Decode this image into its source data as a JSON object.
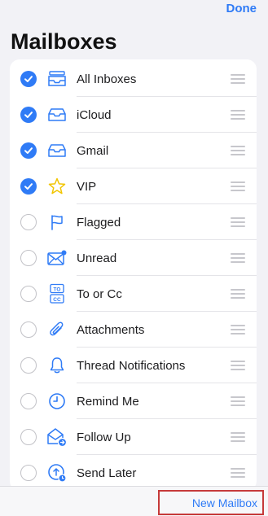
{
  "header": {
    "done_label": "Done",
    "title": "Mailboxes"
  },
  "colors": {
    "accent": "#2f7bf6",
    "vip_star": "#f2c500",
    "highlight_border": "#c63a3a"
  },
  "mailboxes": [
    {
      "label": "All Inboxes",
      "checked": true,
      "icon": "all-inboxes-icon"
    },
    {
      "label": "iCloud",
      "checked": true,
      "icon": "inbox-tray-icon"
    },
    {
      "label": "Gmail",
      "checked": true,
      "icon": "inbox-tray-icon"
    },
    {
      "label": "VIP",
      "checked": true,
      "icon": "star-icon"
    },
    {
      "label": "Flagged",
      "checked": false,
      "icon": "flag-icon"
    },
    {
      "label": "Unread",
      "checked": false,
      "icon": "unread-envelope-icon"
    },
    {
      "label": "To or Cc",
      "checked": false,
      "icon": "to-cc-icon",
      "icon_text_top": "TO",
      "icon_text_bottom": "CC"
    },
    {
      "label": "Attachments",
      "checked": false,
      "icon": "paperclip-icon"
    },
    {
      "label": "Thread Notifications",
      "checked": false,
      "icon": "bell-icon"
    },
    {
      "label": "Remind Me",
      "checked": false,
      "icon": "clock-icon"
    },
    {
      "label": "Follow Up",
      "checked": false,
      "icon": "follow-up-envelope-icon"
    },
    {
      "label": "Send Later",
      "checked": false,
      "icon": "send-later-clock-icon"
    }
  ],
  "footer": {
    "new_mailbox_label": "New Mailbox"
  }
}
